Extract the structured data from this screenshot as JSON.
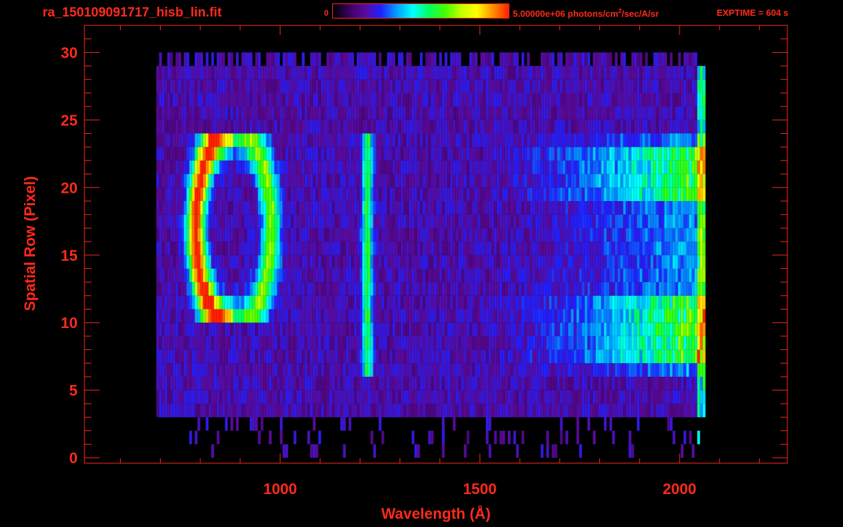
{
  "file_title": "ra_150109091717_hisb_lin.fit",
  "colorbar": {
    "min_label": "0",
    "max_label_pre": "5.00000e+06 photons/cm",
    "max_label_sup": "2",
    "max_label_post": "/sec/A/sr",
    "colormap": [
      "#000000",
      "#3a0060",
      "#5a0a9a",
      "#2020ff",
      "#00a0ff",
      "#00ffff",
      "#00ff60",
      "#40ff00",
      "#c0ff00",
      "#ffff00",
      "#ff9000",
      "#ff2000"
    ]
  },
  "exptime": "EXPTIME = 604 s",
  "colors": {
    "axis": "#ff2a1a",
    "background": "#000000"
  },
  "chart_data": {
    "type": "heatmap",
    "title": "ra_150109091717_hisb_lin.fit",
    "xlabel": "Wavelength (Å)",
    "ylabel": "Spatial Row (Pixel)",
    "xlim": [
      510,
      2270
    ],
    "ylim": [
      -0.4,
      32
    ],
    "xticks": [
      1000,
      1500,
      2000
    ],
    "xtick_labels": [
      "1000",
      "1500",
      "2000"
    ],
    "yticks": [
      0,
      5,
      10,
      15,
      20,
      25,
      30
    ],
    "ytick_labels": [
      "0",
      "5",
      "10",
      "15",
      "20",
      "25",
      "30"
    ],
    "data_extent": {
      "x": [
        690,
        2070
      ],
      "y": [
        0,
        30
      ]
    },
    "value_range": [
      0,
      5000000
    ],
    "features": [
      {
        "name": "arc",
        "x_range": [
          780,
          1000
        ],
        "y_range": [
          10,
          24
        ],
        "peak": "left edge near x=800, rows 13-20"
      },
      {
        "name": "line",
        "x_center": 1215,
        "y_range": [
          6,
          24
        ]
      },
      {
        "name": "continuum",
        "x_range": [
          1500,
          2070
        ],
        "y_range": [
          6,
          24
        ],
        "brightest_rows": [
          [
            7,
            12
          ],
          [
            19,
            23
          ]
        ]
      }
    ]
  }
}
